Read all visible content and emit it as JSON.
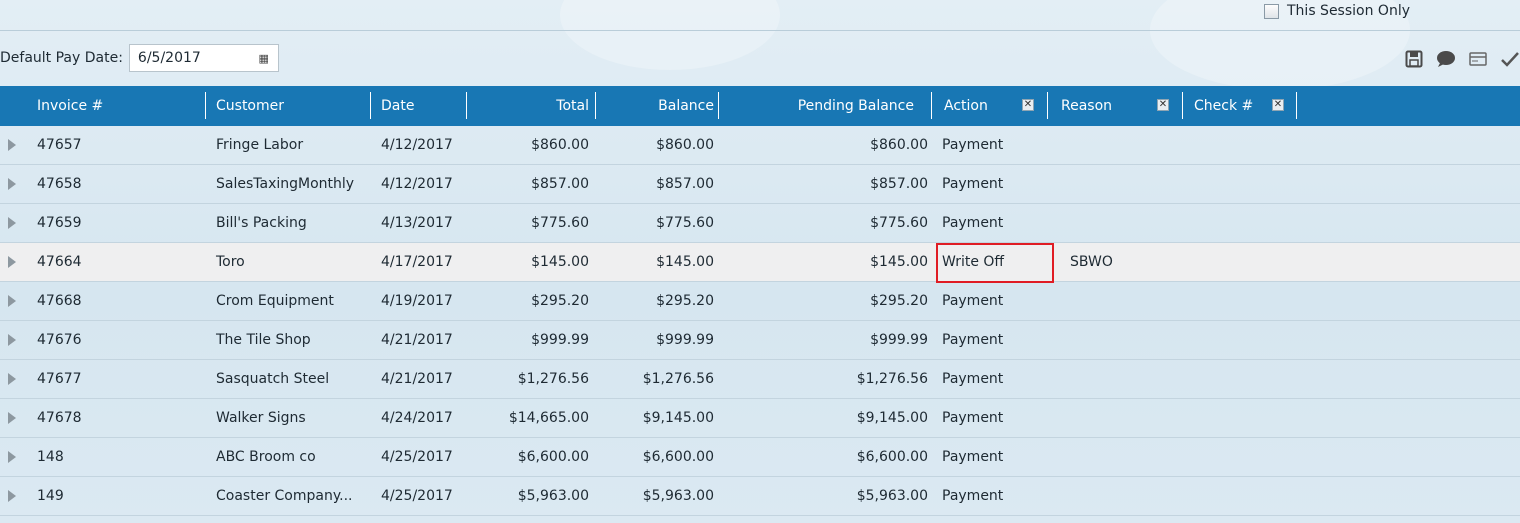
{
  "session_only": {
    "label": "This Session Only",
    "checked": false
  },
  "pay_date": {
    "label": "Default Pay Date:",
    "value": "6/5/2017"
  },
  "toolbar": {
    "icons": [
      "save-icon",
      "comment-icon",
      "card-icon",
      "checkmark-icon"
    ]
  },
  "columns": {
    "invoice": "Invoice #",
    "customer": "Customer",
    "date": "Date",
    "total": "Total",
    "balance": "Balance",
    "pending": "Pending Balance",
    "action": "Action",
    "reason": "Reason",
    "check": "Check #"
  },
  "rows": [
    {
      "invoice": "47657",
      "customer": "Fringe Labor",
      "date": "4/12/2017",
      "total": "$860.00",
      "balance": "$860.00",
      "pending": "$860.00",
      "action": "Payment",
      "reason": "",
      "check": ""
    },
    {
      "invoice": "47658",
      "customer": "SalesTaxingMonthly",
      "date": "4/12/2017",
      "total": "$857.00",
      "balance": "$857.00",
      "pending": "$857.00",
      "action": "Payment",
      "reason": "",
      "check": ""
    },
    {
      "invoice": "47659",
      "customer": "Bill's Packing",
      "date": "4/13/2017",
      "total": "$775.60",
      "balance": "$775.60",
      "pending": "$775.60",
      "action": "Payment",
      "reason": "",
      "check": ""
    },
    {
      "invoice": "47664",
      "customer": "Toro",
      "date": "4/17/2017",
      "total": "$145.00",
      "balance": "$145.00",
      "pending": "$145.00",
      "action": "Write Off",
      "reason": "SBWO",
      "check": "",
      "selected": true
    },
    {
      "invoice": "47668",
      "customer": "Crom Equipment",
      "date": "4/19/2017",
      "total": "$295.20",
      "balance": "$295.20",
      "pending": "$295.20",
      "action": "Payment",
      "reason": "",
      "check": ""
    },
    {
      "invoice": "47676",
      "customer": "The Tile Shop",
      "date": "4/21/2017",
      "total": "$999.99",
      "balance": "$999.99",
      "pending": "$999.99",
      "action": "Payment",
      "reason": "",
      "check": ""
    },
    {
      "invoice": "47677",
      "customer": "Sasquatch Steel",
      "date": "4/21/2017",
      "total": "$1,276.56",
      "balance": "$1,276.56",
      "pending": "$1,276.56",
      "action": "Payment",
      "reason": "",
      "check": ""
    },
    {
      "invoice": "47678",
      "customer": "Walker Signs",
      "date": "4/24/2017",
      "total": "$14,665.00",
      "balance": "$9,145.00",
      "pending": "$9,145.00",
      "action": "Payment",
      "reason": "",
      "check": ""
    },
    {
      "invoice": "148",
      "customer": " ABC Broom co",
      "date": "4/25/2017",
      "total": "$6,600.00",
      "balance": "$6,600.00",
      "pending": "$6,600.00",
      "action": "Payment",
      "reason": "",
      "check": ""
    },
    {
      "invoice": "149",
      "customer": "Coaster Company...",
      "date": "4/25/2017",
      "total": "$5,963.00",
      "balance": "$5,963.00",
      "pending": "$5,963.00",
      "action": "Payment",
      "reason": "",
      "check": ""
    }
  ],
  "colors": {
    "header_bg": "#1877b4",
    "highlight": "#e01c24",
    "selected_row": "#efeff0"
  }
}
